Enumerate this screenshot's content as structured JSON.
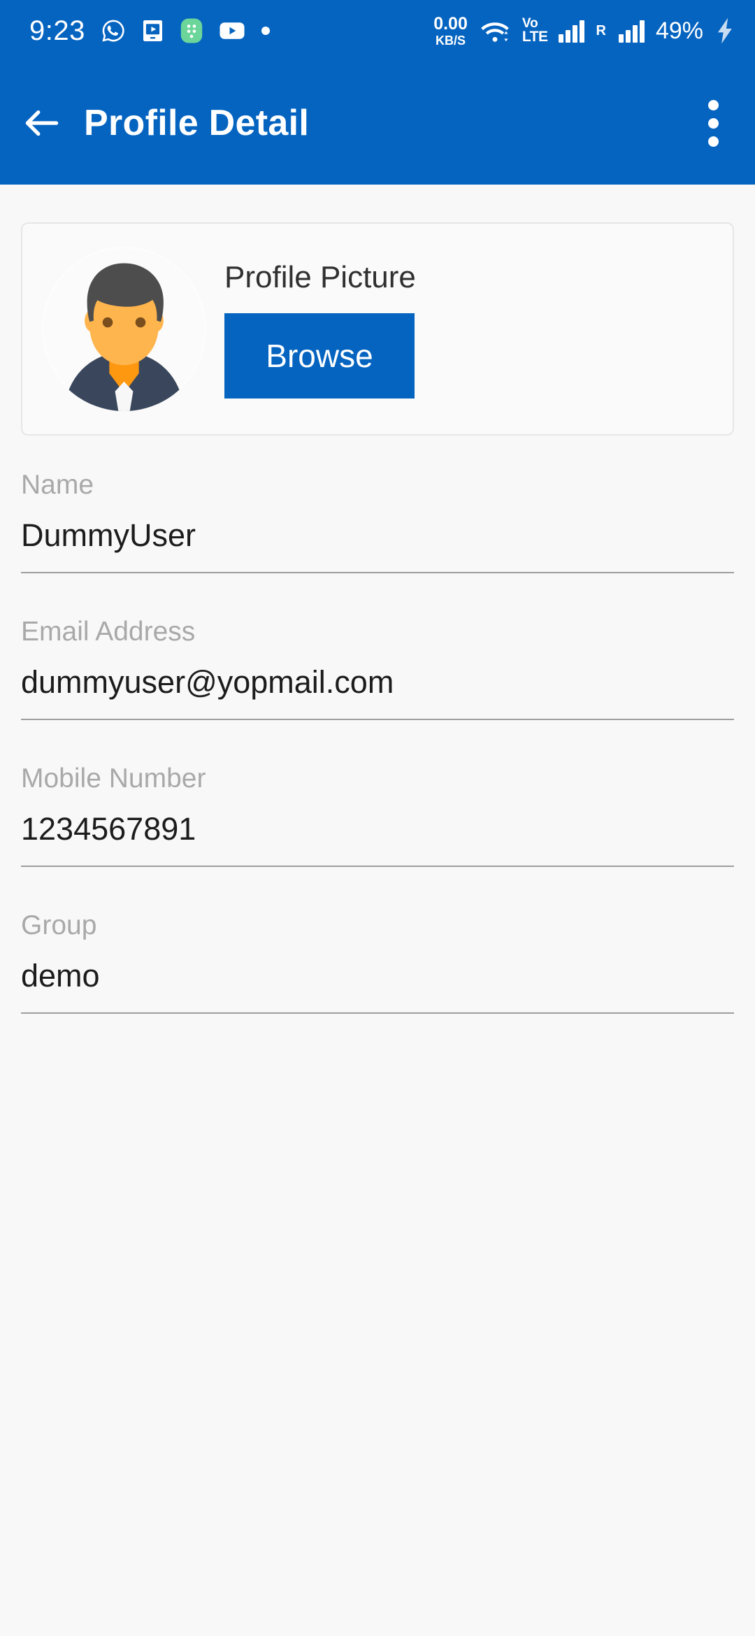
{
  "status_bar": {
    "time": "9:23",
    "left_icons": [
      "whatsapp-icon",
      "video-player-icon",
      "green-app-icon",
      "youtube-icon",
      "dot-indicator-icon"
    ],
    "net_speed_value": "0.00",
    "net_speed_unit": "KB/S",
    "wifi_icon": "wifi-icon",
    "volte_line1": "Vo",
    "volte_line2": "LTE",
    "sim1_signal_icon": "signal-bars-icon",
    "roaming_label": "R",
    "sim2_signal_icon": "signal-bars-icon",
    "battery_percent": "49%",
    "charging_icon": "charging-bolt-icon"
  },
  "app_bar": {
    "back_icon": "back-arrow-icon",
    "title": "Profile Detail",
    "overflow_icon": "more-vertical-icon"
  },
  "profile_picture_card": {
    "avatar_icon": "user-avatar-illustration",
    "title": "Profile Picture",
    "browse_label": "Browse"
  },
  "form": {
    "fields": [
      {
        "label": "Name",
        "value": "DummyUser"
      },
      {
        "label": "Email Address",
        "value": "dummyuser@yopmail.com"
      },
      {
        "label": "Mobile Number",
        "value": "1234567891"
      },
      {
        "label": "Group",
        "value": "demo"
      }
    ]
  },
  "colors": {
    "primary": "#0564c0",
    "background": "#f8f8f8",
    "label_gray": "#a9a9a9",
    "value_dark": "#1c1c1c",
    "underline": "#9e9e9e"
  }
}
